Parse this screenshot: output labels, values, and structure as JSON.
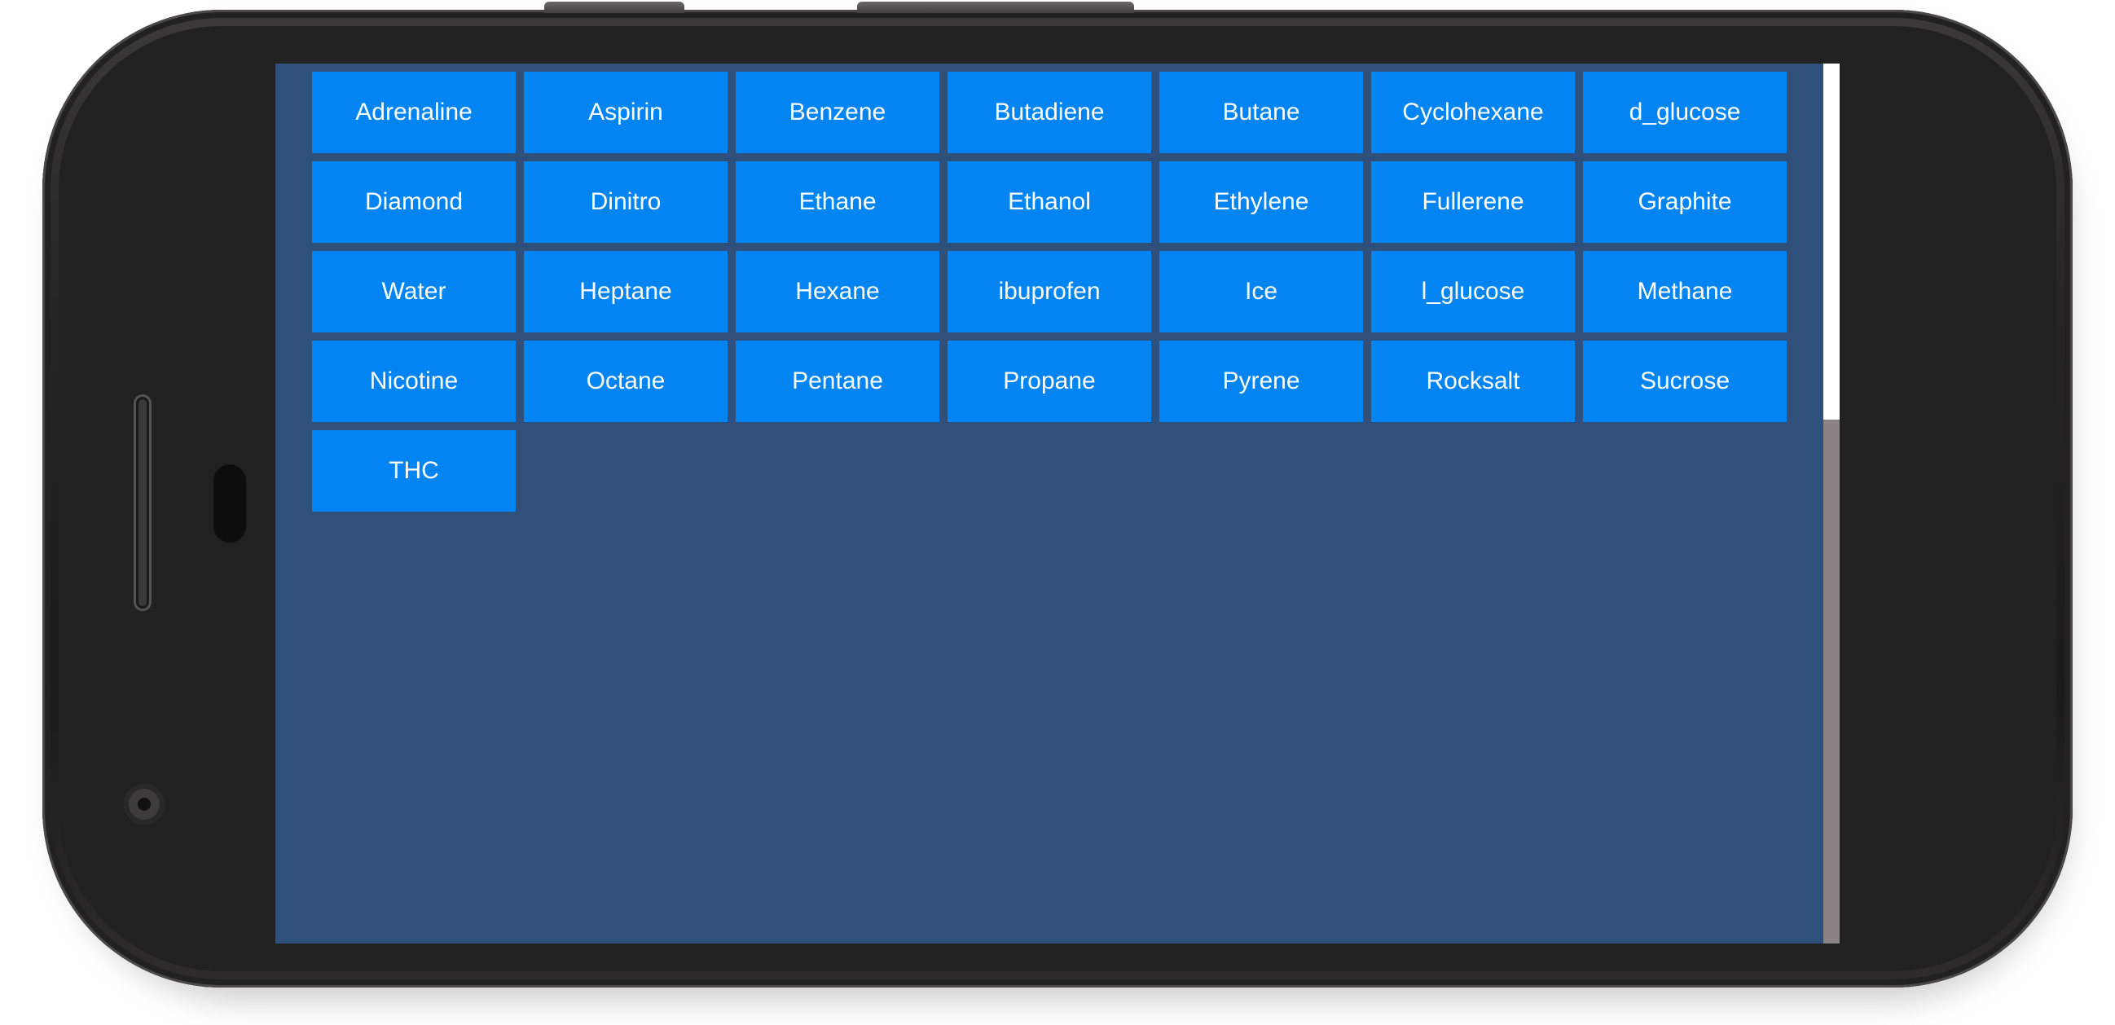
{
  "molecule_buttons": [
    "Adrenaline",
    "Aspirin",
    "Benzene",
    "Butadiene",
    "Butane",
    "Cyclohexane",
    "d_glucose",
    "Diamond",
    "Dinitro",
    "Ethane",
    "Ethanol",
    "Ethylene",
    "Fullerene",
    "Graphite",
    "Water",
    "Heptane",
    "Hexane",
    "ibuprofen",
    "Ice",
    "l_glucose",
    "Methane",
    "Nicotine",
    "Octane",
    "Pentane",
    "Propane",
    "Pyrene",
    "Rocksalt",
    "Sucrose",
    "THC"
  ],
  "colors": {
    "screen_background": "#30507c",
    "button_background": "#0285f2",
    "button_text": "#ffffff",
    "scroll_track": "#8b8282",
    "scroll_thumb": "#ffffff"
  },
  "scrollbar": {
    "visible_fraction": 0.405
  }
}
